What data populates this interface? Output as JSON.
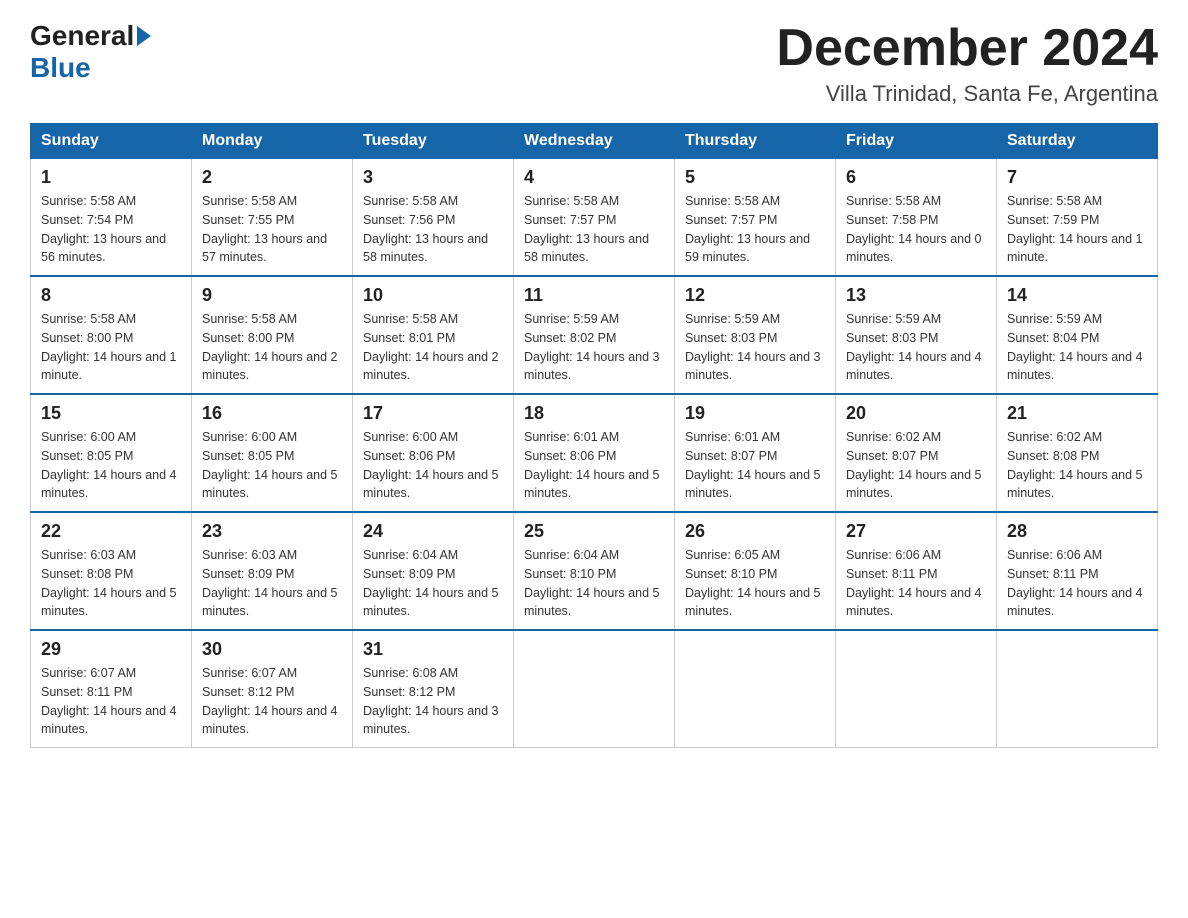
{
  "logo": {
    "general": "General",
    "blue": "Blue"
  },
  "title": "December 2024",
  "subtitle": "Villa Trinidad, Santa Fe, Argentina",
  "weekdays": [
    "Sunday",
    "Monday",
    "Tuesday",
    "Wednesday",
    "Thursday",
    "Friday",
    "Saturday"
  ],
  "weeks": [
    [
      {
        "day": 1,
        "sunrise": "5:58 AM",
        "sunset": "7:54 PM",
        "daylight": "13 hours and 56 minutes."
      },
      {
        "day": 2,
        "sunrise": "5:58 AM",
        "sunset": "7:55 PM",
        "daylight": "13 hours and 57 minutes."
      },
      {
        "day": 3,
        "sunrise": "5:58 AM",
        "sunset": "7:56 PM",
        "daylight": "13 hours and 58 minutes."
      },
      {
        "day": 4,
        "sunrise": "5:58 AM",
        "sunset": "7:57 PM",
        "daylight": "13 hours and 58 minutes."
      },
      {
        "day": 5,
        "sunrise": "5:58 AM",
        "sunset": "7:57 PM",
        "daylight": "13 hours and 59 minutes."
      },
      {
        "day": 6,
        "sunrise": "5:58 AM",
        "sunset": "7:58 PM",
        "daylight": "14 hours and 0 minutes."
      },
      {
        "day": 7,
        "sunrise": "5:58 AM",
        "sunset": "7:59 PM",
        "daylight": "14 hours and 1 minute."
      }
    ],
    [
      {
        "day": 8,
        "sunrise": "5:58 AM",
        "sunset": "8:00 PM",
        "daylight": "14 hours and 1 minute."
      },
      {
        "day": 9,
        "sunrise": "5:58 AM",
        "sunset": "8:00 PM",
        "daylight": "14 hours and 2 minutes."
      },
      {
        "day": 10,
        "sunrise": "5:58 AM",
        "sunset": "8:01 PM",
        "daylight": "14 hours and 2 minutes."
      },
      {
        "day": 11,
        "sunrise": "5:59 AM",
        "sunset": "8:02 PM",
        "daylight": "14 hours and 3 minutes."
      },
      {
        "day": 12,
        "sunrise": "5:59 AM",
        "sunset": "8:03 PM",
        "daylight": "14 hours and 3 minutes."
      },
      {
        "day": 13,
        "sunrise": "5:59 AM",
        "sunset": "8:03 PM",
        "daylight": "14 hours and 4 minutes."
      },
      {
        "day": 14,
        "sunrise": "5:59 AM",
        "sunset": "8:04 PM",
        "daylight": "14 hours and 4 minutes."
      }
    ],
    [
      {
        "day": 15,
        "sunrise": "6:00 AM",
        "sunset": "8:05 PM",
        "daylight": "14 hours and 4 minutes."
      },
      {
        "day": 16,
        "sunrise": "6:00 AM",
        "sunset": "8:05 PM",
        "daylight": "14 hours and 5 minutes."
      },
      {
        "day": 17,
        "sunrise": "6:00 AM",
        "sunset": "8:06 PM",
        "daylight": "14 hours and 5 minutes."
      },
      {
        "day": 18,
        "sunrise": "6:01 AM",
        "sunset": "8:06 PM",
        "daylight": "14 hours and 5 minutes."
      },
      {
        "day": 19,
        "sunrise": "6:01 AM",
        "sunset": "8:07 PM",
        "daylight": "14 hours and 5 minutes."
      },
      {
        "day": 20,
        "sunrise": "6:02 AM",
        "sunset": "8:07 PM",
        "daylight": "14 hours and 5 minutes."
      },
      {
        "day": 21,
        "sunrise": "6:02 AM",
        "sunset": "8:08 PM",
        "daylight": "14 hours and 5 minutes."
      }
    ],
    [
      {
        "day": 22,
        "sunrise": "6:03 AM",
        "sunset": "8:08 PM",
        "daylight": "14 hours and 5 minutes."
      },
      {
        "day": 23,
        "sunrise": "6:03 AM",
        "sunset": "8:09 PM",
        "daylight": "14 hours and 5 minutes."
      },
      {
        "day": 24,
        "sunrise": "6:04 AM",
        "sunset": "8:09 PM",
        "daylight": "14 hours and 5 minutes."
      },
      {
        "day": 25,
        "sunrise": "6:04 AM",
        "sunset": "8:10 PM",
        "daylight": "14 hours and 5 minutes."
      },
      {
        "day": 26,
        "sunrise": "6:05 AM",
        "sunset": "8:10 PM",
        "daylight": "14 hours and 5 minutes."
      },
      {
        "day": 27,
        "sunrise": "6:06 AM",
        "sunset": "8:11 PM",
        "daylight": "14 hours and 4 minutes."
      },
      {
        "day": 28,
        "sunrise": "6:06 AM",
        "sunset": "8:11 PM",
        "daylight": "14 hours and 4 minutes."
      }
    ],
    [
      {
        "day": 29,
        "sunrise": "6:07 AM",
        "sunset": "8:11 PM",
        "daylight": "14 hours and 4 minutes."
      },
      {
        "day": 30,
        "sunrise": "6:07 AM",
        "sunset": "8:12 PM",
        "daylight": "14 hours and 4 minutes."
      },
      {
        "day": 31,
        "sunrise": "6:08 AM",
        "sunset": "8:12 PM",
        "daylight": "14 hours and 3 minutes."
      },
      null,
      null,
      null,
      null
    ]
  ]
}
